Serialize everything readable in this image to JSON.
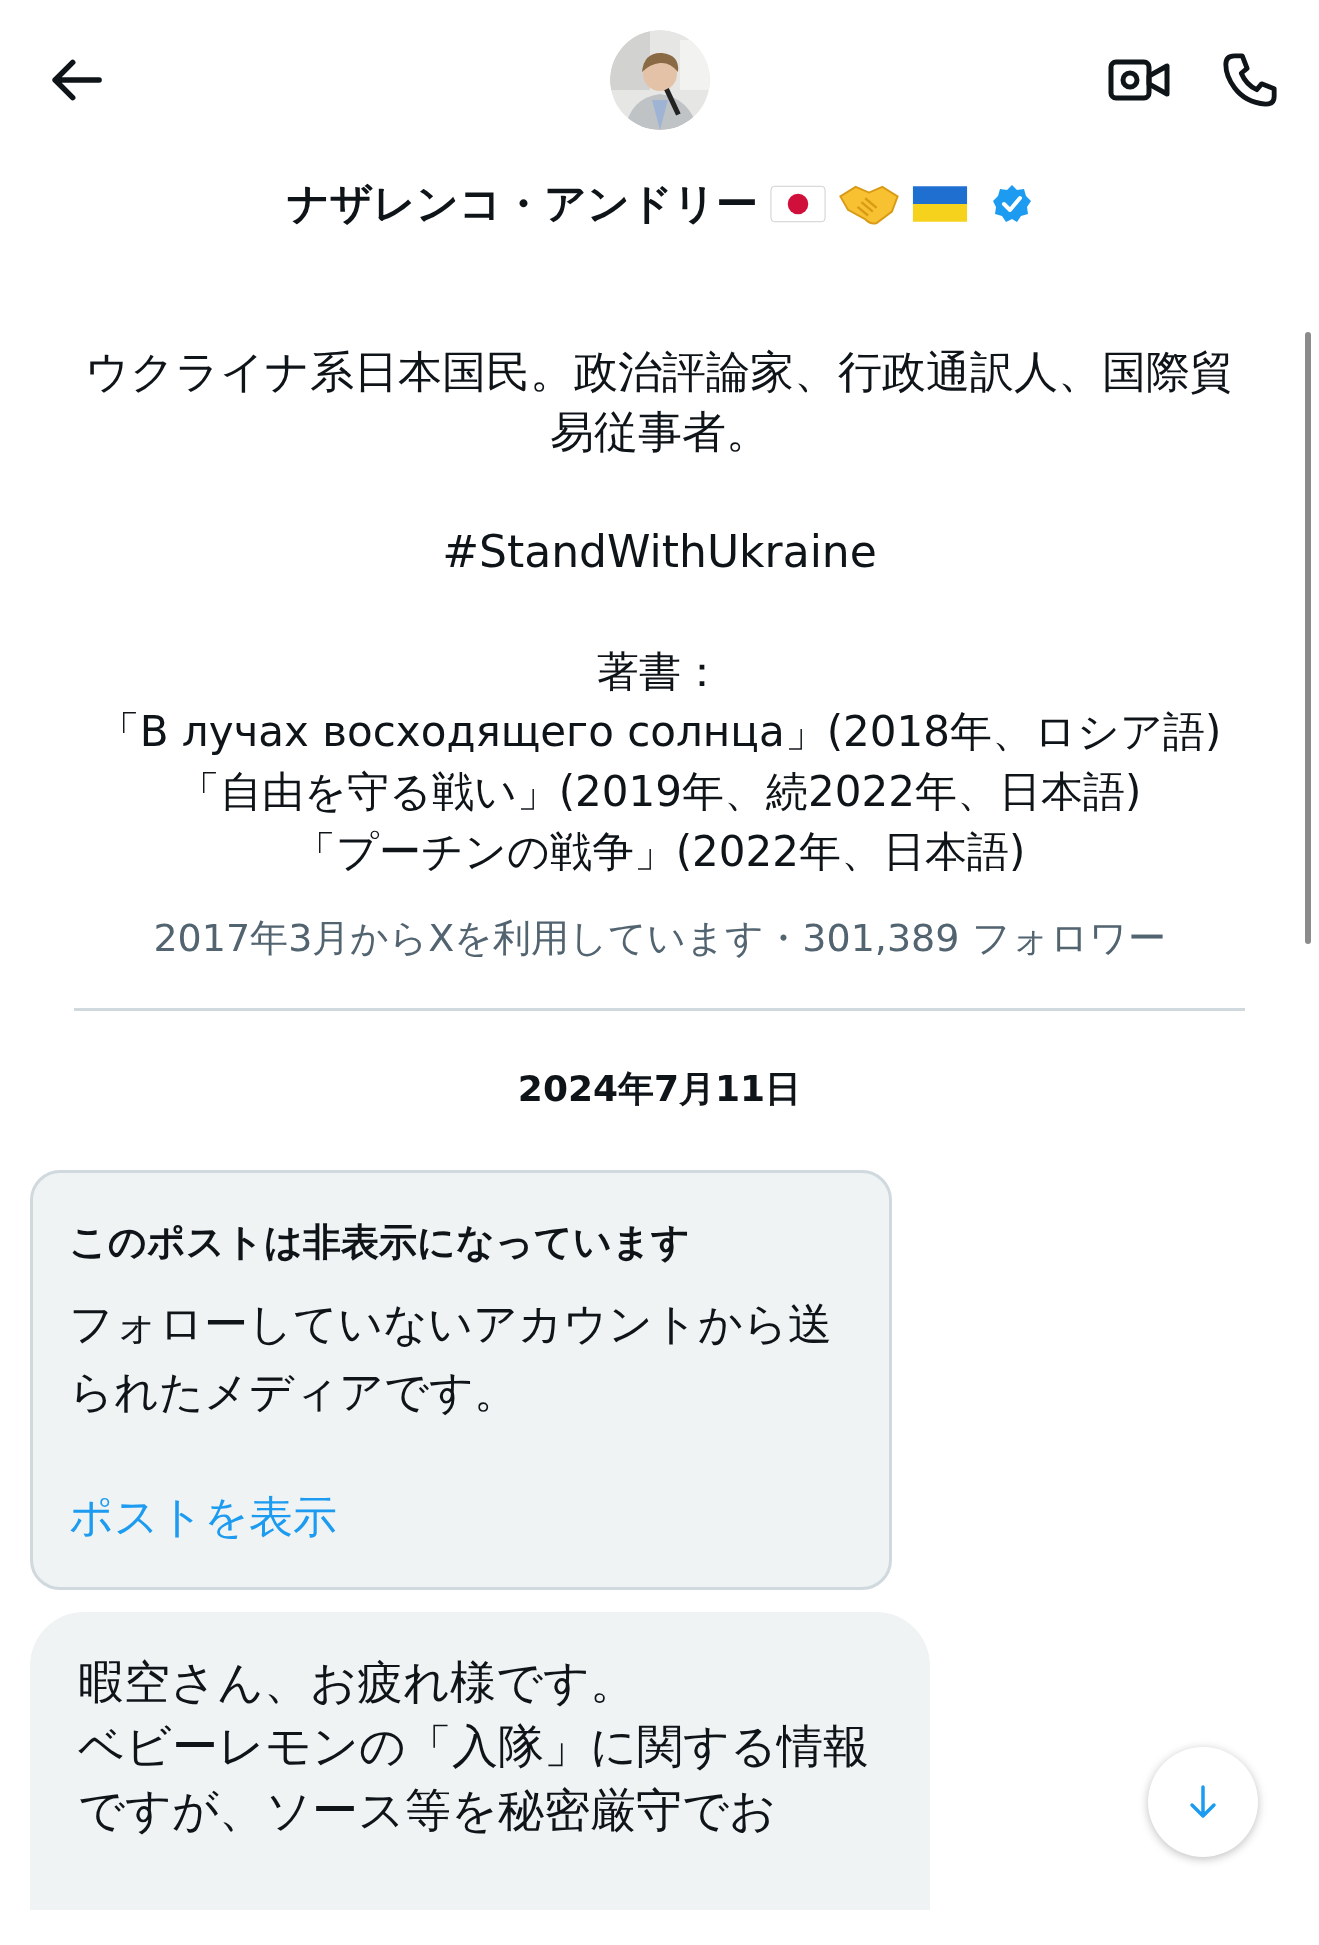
{
  "header": {
    "name": "ナザレンコ・アンドリー",
    "verified": true
  },
  "bio": [
    "ウクライナ系日本国民。政治評論家、行政通訳人、国際貿易従事者。",
    "#StandWithUkraine"
  ],
  "books": {
    "heading": "著書：",
    "titles": [
      "「В лучах восходящего солнца」(2018年、ロシア語)",
      "「自由を守る戦い」(2019年、続2022年、日本語)",
      "「プーチンの戦争」(2022年、日本語)"
    ]
  },
  "meta": "2017年3月からXを利用しています・301,389 フォロワー",
  "date": "2024年7月11日",
  "hidden_post": {
    "title": "このポストは非表示になっています",
    "body": "フォローしていないアカウントから送られたメディアです。",
    "link": "ポストを表示"
  },
  "message": {
    "lines": [
      "暇空さん、お疲れ様です。",
      "ベビーレモンの「入隊」に関する情報ですが、ソース等を秘密厳守でお"
    ]
  }
}
